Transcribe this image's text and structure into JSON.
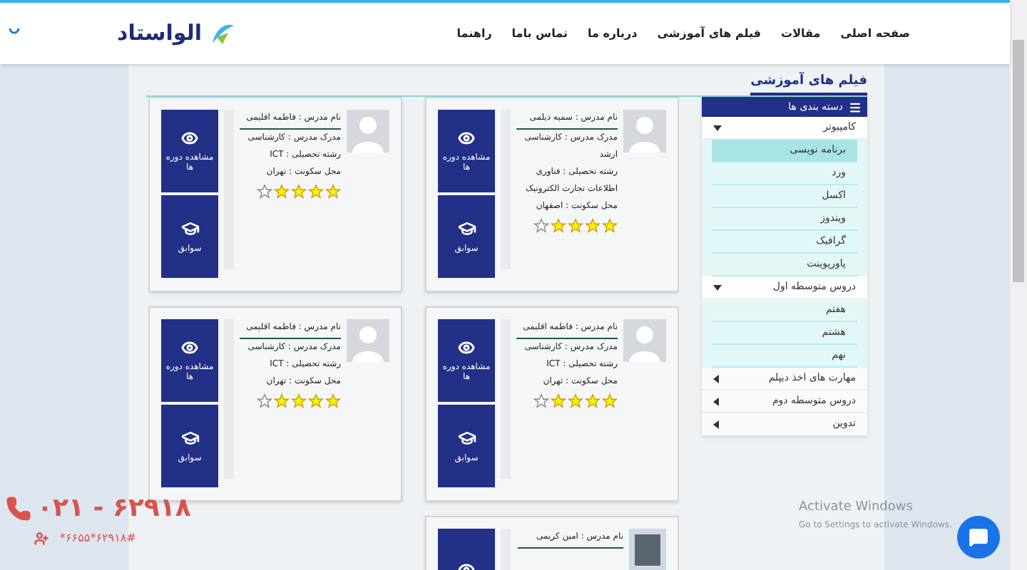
{
  "header": {
    "logo": "الواستاد",
    "nav": [
      "صفحه اصلی",
      "مقالات",
      "فیلم های آموزشی",
      "درباره ما",
      "تماس باما",
      "راهنما"
    ]
  },
  "page_title": "فیلم های آموزشی",
  "sidebar": {
    "title": "دسته بندی ها",
    "groups": [
      {
        "label": "کامپیوتر",
        "expanded": true,
        "children": [
          {
            "label": "برنامه نویسی",
            "selected": true
          },
          {
            "label": "ورد",
            "selected": false
          },
          {
            "label": "اکسل",
            "selected": false
          },
          {
            "label": "ویندوز",
            "selected": false
          },
          {
            "label": "گرافیک",
            "selected": false
          },
          {
            "label": "پاورپوینت",
            "selected": false
          }
        ]
      },
      {
        "label": "دروس متوسطه اول",
        "expanded": true,
        "children": [
          {
            "label": "هفتم",
            "selected": false
          },
          {
            "label": "هشتم",
            "selected": false
          },
          {
            "label": "نهم",
            "selected": false
          }
        ]
      },
      {
        "label": "مهارت های اخذ دیپلم",
        "expanded": false
      },
      {
        "label": "دروس متوسطه دوم",
        "expanded": false
      },
      {
        "label": "تدوین",
        "expanded": false
      }
    ]
  },
  "teachers": [
    {
      "kind": "silhouette",
      "name": "نام مدرس : سمیه دیلمی",
      "degree": "مدرک مدرس : کارشناسی ارشد",
      "field": "رشته تحصیلی : فناوری اطلاعات تجارت الکترونیک",
      "city": "محل سکونت : اصفهان",
      "stars": 4,
      "buttons": [
        {
          "kind": "courses",
          "label": "مشاهده دوره ها"
        },
        {
          "kind": "history",
          "label": "سوابق"
        }
      ]
    },
    {
      "kind": "silhouette",
      "name": "نام مدرس : فاطمه اقلیمی",
      "degree": "مدرک مدرس : کارشناسی",
      "field": "رشته تحصیلی : ICT",
      "city": "محل سکونت : تهران",
      "stars": 4,
      "buttons": [
        {
          "kind": "courses",
          "label": "مشاهده دوره ها"
        },
        {
          "kind": "history",
          "label": "سوابق"
        }
      ]
    },
    {
      "kind": "silhouette",
      "name": "نام مدرس : فاطمه اقلیمی",
      "degree": "مدرک مدرس : کارشناسی",
      "field": "رشته تحصیلی : ICT",
      "city": "محل سکونت : تهران",
      "stars": 4,
      "buttons": [
        {
          "kind": "courses",
          "label": "مشاهده دوره ها"
        },
        {
          "kind": "history",
          "label": "سوابق"
        }
      ]
    },
    {
      "kind": "silhouette",
      "name": "نام مدرس : فاطمه اقلیمی",
      "degree": "مدرک مدرس : کارشناسی",
      "field": "رشته تحصیلی : ICT",
      "city": "محل سکونت : تهران",
      "stars": 4,
      "buttons": [
        {
          "kind": "courses",
          "label": "مشاهده دوره ها"
        },
        {
          "kind": "history",
          "label": "سوابق"
        }
      ]
    },
    {
      "kind": "photo",
      "name": "نام مدرس : امین کریمی",
      "buttons": [
        {
          "kind": "courses"
        }
      ]
    }
  ],
  "contact": {
    "phone": "۰۲۱ - ۶۲۹۱۸",
    "ussd": "*۶۶۵۵*۶۲۹۱۸#"
  },
  "os_notice": {
    "title": "Activate Windows",
    "text": "Go to Settings to activate Windows."
  }
}
